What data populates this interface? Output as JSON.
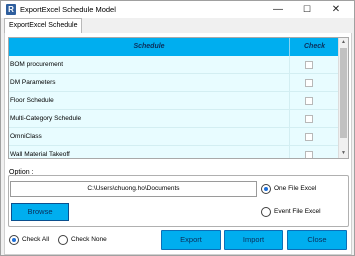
{
  "window": {
    "title": "ExportExcel Schedule Model",
    "app_icon": "R",
    "controls": {
      "minimize": "—",
      "maximize": "☐",
      "close": "✕"
    }
  },
  "tab": {
    "label": "ExportExcel Schedule"
  },
  "grid": {
    "columns": [
      "Schedule",
      "Check"
    ],
    "rows": [
      {
        "name": "BOM procurement",
        "checked": false
      },
      {
        "name": "DM Parameters",
        "checked": false
      },
      {
        "name": "Floor Schedule",
        "checked": false
      },
      {
        "name": "Multi-Category Schedule",
        "checked": false
      },
      {
        "name": "OmniClass",
        "checked": false
      },
      {
        "name": "Wall Material Takeoff",
        "checked": false
      }
    ]
  },
  "options": {
    "label": "Option :",
    "path_value": "C:\\Users\\chuong.ho\\Documents",
    "browse_label": "Browse",
    "one_file_label": "One File Excel",
    "event_file_label": "Event File Excel",
    "selected": "one_file"
  },
  "footer": {
    "check_all_label": "Check All",
    "check_none_label": "Check None",
    "selected": "check_all",
    "export_label": "Export",
    "import_label": "Import",
    "close_label": "Close"
  },
  "colors": {
    "accent": "#00aeef",
    "row_background": "#e8fcff",
    "header_text": "#0b2e59"
  }
}
